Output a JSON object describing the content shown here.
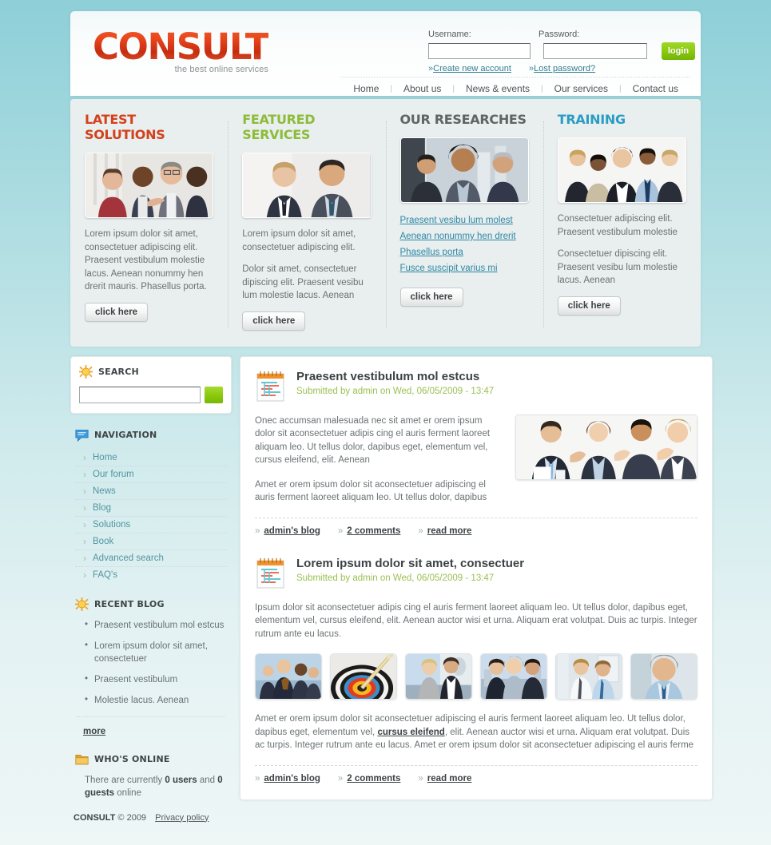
{
  "brand": {
    "logo": "CONSULT",
    "tagline": "the best online services"
  },
  "login": {
    "username_label": "Username:",
    "password_label": "Password:",
    "username_value": "",
    "password_value": "",
    "button_label": "login",
    "create_account": "Create new account",
    "lost_password": "Lost password?",
    "prefix": "»"
  },
  "nav": {
    "items": [
      {
        "label": "Home"
      },
      {
        "label": "About us"
      },
      {
        "label": "News & events"
      },
      {
        "label": "Our services"
      },
      {
        "label": "Contact us"
      }
    ],
    "divider": "|"
  },
  "features": [
    {
      "title": "LATEST SOLUTIONS",
      "color": "#d2421c",
      "image_name": "business-meeting-photo",
      "paragraphs": [
        "Lorem ipsum dolor sit amet, consectetuer adipiscing elit. Praesent vestibulum molestie lacus. Aenean nonummy hen drerit mauris. Phasellus porta."
      ],
      "links": [],
      "button": "click here"
    },
    {
      "title": "FEATURED SERVICES",
      "color": "#8cbc3a",
      "image_name": "two-businessmen-photo",
      "paragraphs": [
        "Lorem ipsum dolor sit amet, consectetuer adipiscing elit.",
        "Dolor sit amet, consectetuer dipiscing elit. Praesent vesibu lum molestie lacus. Aenean"
      ],
      "links": [],
      "button": "click here"
    },
    {
      "title": "OUR RESEARCHES",
      "color": "#5d6567",
      "image_name": "office-team-photo",
      "paragraphs": [],
      "links": [
        "Praesent vesibu lum molest",
        "Aenean nonummy hen drerit",
        "Phasellus porta",
        "Fusce suscipit varius mi"
      ],
      "button": "click here"
    },
    {
      "title": "TRAINING",
      "color": "#2a9cc4",
      "image_name": "diverse-group-photo",
      "paragraphs": [
        "Consectetuer adipiscing elit. Praesent vestibulum molestie",
        "Consectetuer dipiscing elit. Praesent vesibu lum molestie lacus. Aenean"
      ],
      "links": [],
      "button": "click here"
    }
  ],
  "sidebar": {
    "search": {
      "heading": "SEARCH",
      "icon": "sun-icon",
      "value": "",
      "placeholder": "",
      "button_label": ""
    },
    "navigation": {
      "heading": "NAVIGATION",
      "icon": "speech-bubble-icon",
      "items": [
        {
          "label": "Home"
        },
        {
          "label": "Our forum"
        },
        {
          "label": "News"
        },
        {
          "label": "Blog"
        },
        {
          "label": "Solutions"
        },
        {
          "label": "Book"
        },
        {
          "label": "Advanced search"
        },
        {
          "label": "FAQ's"
        }
      ]
    },
    "recent_blog": {
      "heading": "RECENT BLOG",
      "icon": "sun-icon",
      "items": [
        "Praesent vestibulum mol estcus",
        "Lorem ipsum dolor sit amet, consectetuer",
        "Praesent vestibulum",
        "Molestie lacus. Aenean"
      ],
      "more_label": "more"
    },
    "whos_online": {
      "heading": "WHO'S ONLINE",
      "icon": "folder-icon",
      "text_before": "There are currently ",
      "users_count": "0 users",
      "text_middle": " and ",
      "guests_count": "0 guests",
      "text_after": " online"
    }
  },
  "posts": [
    {
      "icon": "calendar-notepad-icon",
      "title": "Praesent vestibulum mol estcus",
      "meta": "Submitted by admin on Wed, 06/05/2009 - 13:47",
      "paragraphs": [
        "Onec accumsan malesuada nec sit amet er orem ipsum dolor sit aconsectetuer adipis cing el auris ferment laoreet aliquam leo. Ut tellus dolor, dapibus eget, elementum vel, cursus eleifend, elit. Aenean",
        "Amet er orem ipsum dolor sit aconsectetuer adipiscing el auris ferment laoreet aliquam leo. Ut tellus dolor, dapibus"
      ],
      "image_name": "applauding-team-photo",
      "links": [
        {
          "label": "admin's blog"
        },
        {
          "label": "2 comments"
        },
        {
          "label": "read more"
        }
      ],
      "link_prefix": "»"
    },
    {
      "icon": "calendar-notepad-icon",
      "title": "Lorem ipsum dolor sit amet, consectuer",
      "meta": "Submitted by admin on Wed, 06/05/2009 - 13:47",
      "paragraphs": [
        "Ipsum dolor sit aconsectetuer adipis cing el auris ferment laoreet aliquam leo. Ut tellus dolor, dapibus eget, elementum vel, cursus eleifend, elit. Aenean auctor wisi et urna. Aliquam erat volutpat. Duis ac turpis. Integer rutrum ante eu lacus."
      ],
      "thumbnails": [
        "business-group-trophy-thumb",
        "dartboard-target-thumb",
        "couple-airplane-thumb",
        "three-colleagues-thumb",
        "two-men-talking-thumb",
        "businessman-portrait-thumb"
      ],
      "body_before_link": "Amet er orem ipsum dolor sit aconsectetuer adipiscing el auris ferment laoreet aliquam leo. Ut tellus dolor, dapibus eget, elementum vel, ",
      "inline_link": "cursus eleifend",
      "body_after_link": ", elit. Aenean auctor wisi et urna. Aliquam erat volutpat. Duis ac turpis. Integer rutrum ante eu lacus. Amet er orem ipsum dolor sit aconsectetuer adipiscing el auris ferme",
      "links": [
        {
          "label": "admin's blog"
        },
        {
          "label": "2 comments"
        },
        {
          "label": "read more"
        }
      ],
      "link_prefix": "»"
    }
  ],
  "footer": {
    "brand": "CONSULT",
    "copyright": "© 2009",
    "privacy": "Privacy policy"
  }
}
